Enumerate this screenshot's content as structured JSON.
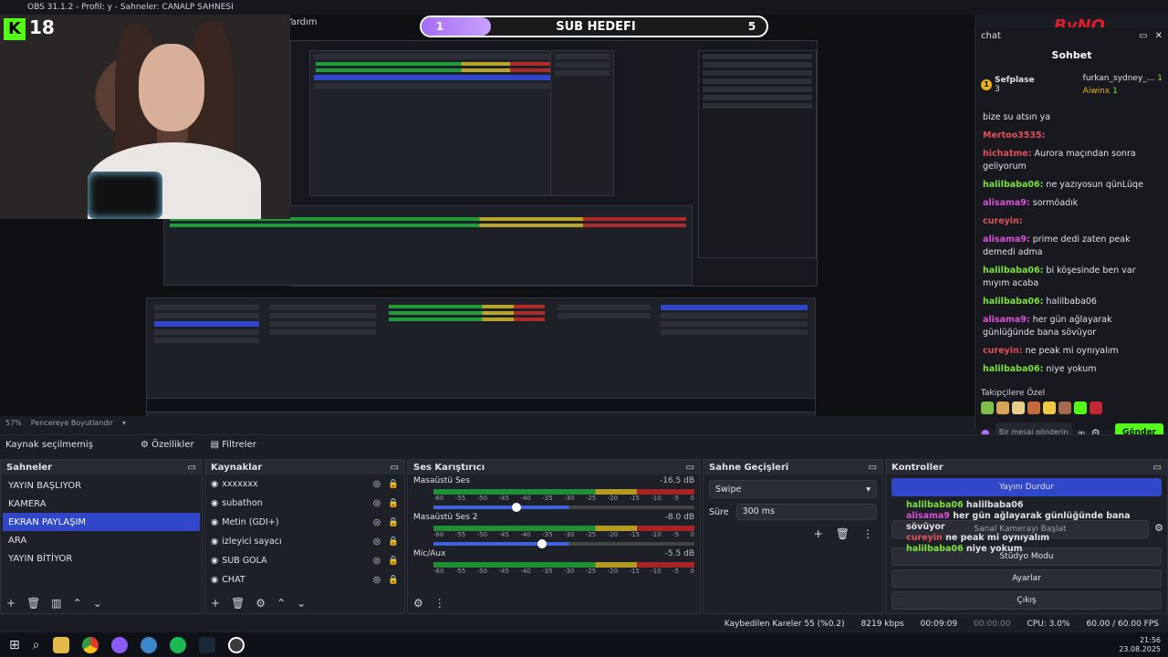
{
  "window": {
    "title": "OBS 31.1.2 - Profil: y - Sahneler: CANALP SAHNESI",
    "menu_last": "Yardım"
  },
  "overlay": {
    "sub_goal_label": "SUB HEDEFI",
    "sub_current": "1",
    "sub_target": "5",
    "sub_progress_fraction": 0.2,
    "logo_text": "ByNO",
    "camera_badge": "18",
    "kick_letter": "K"
  },
  "chat": {
    "panel_title": "chat",
    "header": "Sohbet",
    "pinned": [
      {
        "user": "Sefplase",
        "count": "3"
      },
      {
        "user": "furkan_sydney_...",
        "count": "1"
      },
      {
        "user": "Aiwinx",
        "count": "1"
      }
    ],
    "messages": [
      {
        "user": "",
        "text": "bize su atsın ya",
        "color": "#dfe1e6"
      },
      {
        "user": "Mertoo3535:",
        "text": "",
        "color": "#e0505a"
      },
      {
        "user": "hichatme:",
        "text": "Aurora maçından sonra geliyorum",
        "color": "#e0505a"
      },
      {
        "user": "halilbaba06:",
        "text": "ne yazıyosun qünLüqe",
        "color": "#7be03e"
      },
      {
        "user": "alisama9:",
        "text": "sormöadık",
        "color": "#d94fd9"
      },
      {
        "user": "cureyin:",
        "text": "",
        "color": "#e0505a"
      },
      {
        "user": "alisama9:",
        "text": "prime dedi zaten peak demedi adma",
        "color": "#d94fd9"
      },
      {
        "user": "halilbaba06:",
        "text": "bi köşesinde ben var mıyım acaba",
        "color": "#7be03e"
      },
      {
        "user": "halilbaba06:",
        "text": "halilbaba06",
        "color": "#7be03e"
      },
      {
        "user": "alisama9:",
        "text": "her gün ağlayarak günlüğünde bana sövüyor",
        "color": "#d94fd9"
      },
      {
        "user": "cureyin:",
        "text": "ne peak mi oynıyalım",
        "color": "#e0505a"
      },
      {
        "user": "halilbaba06:",
        "text": "niye yokum",
        "color": "#7be03e"
      }
    ],
    "followers_label": "Takipçilere Özel",
    "input_placeholder": "Bir mesaj gönderin",
    "send_label": "Gönder"
  },
  "zoom": {
    "percent": "57%",
    "fit_label": "Pencereye Boyutlandır"
  },
  "source_bar": {
    "status": "Kaynak seçilmemiş",
    "properties": "Özellikler",
    "filters": "Filtreler"
  },
  "scenes": {
    "title": "Sahneler",
    "items": [
      "YAYIN BAŞLIYOR",
      "KAMERA",
      "EKRAN PAYLAŞIM",
      "ARA",
      "YAYIN BİTİYOR"
    ],
    "selected": 2
  },
  "sources": {
    "title": "Kaynaklar",
    "items": [
      "xxxxxxx",
      "subathon",
      "Metin (GDI+)",
      "izleyici sayacı",
      "SUB GOLA",
      "CHAT"
    ]
  },
  "mixer": {
    "title": "Ses Karıştırıcı",
    "channels": [
      {
        "name": "Masaüstü Ses",
        "db": "-16.5 dB",
        "level": 0.3
      },
      {
        "name": "Masaüstü Ses 2",
        "db": "-8.0 dB",
        "level": 0.4
      },
      {
        "name": "Mic/Aux",
        "db": "-5.5 dB",
        "level": 0.5
      }
    ],
    "ticks": [
      "-60",
      "-55",
      "-50",
      "-45",
      "-40",
      "-35",
      "-30",
      "-25",
      "-20",
      "-15",
      "-10",
      "-5",
      "0"
    ]
  },
  "transitions": {
    "title": "Sahne Geçişleri",
    "type": "Swipe",
    "duration_label": "Süre",
    "duration": "300 ms"
  },
  "controls": {
    "title": "Kontroller",
    "stop_stream": "Yayını Durdur",
    "virtual_cam": "Sanal Kamerayı Başlat",
    "studio": "Stüdyo Modu",
    "settings": "Ayarlar",
    "exit": "Çıkış",
    "overlay_lines": [
      {
        "user": "halilbaba06",
        "text": "halilbaba06",
        "color": "#7be03e"
      },
      {
        "user": "alisama9",
        "text": "her gün ağlayarak günlüğünde bana sövüyor",
        "color": "#d94fd9"
      },
      {
        "user": "cureyin",
        "text": "ne peak mi oynıyalım",
        "color": "#e0505a"
      },
      {
        "user": "halilbaba06",
        "text": "niye yokum",
        "color": "#7be03e"
      }
    ]
  },
  "status": {
    "dropped": "Kaybedilen Kareler 55 (%0.2)",
    "bitrate": "8219 kbps",
    "stream_time": "00:09:09",
    "rec_time": "00:00:00",
    "cpu": "CPU: 3.0%",
    "fps": "60.00 / 60.00 FPS"
  },
  "taskbar": {
    "time": "21:56",
    "date": "23.08.2025"
  }
}
